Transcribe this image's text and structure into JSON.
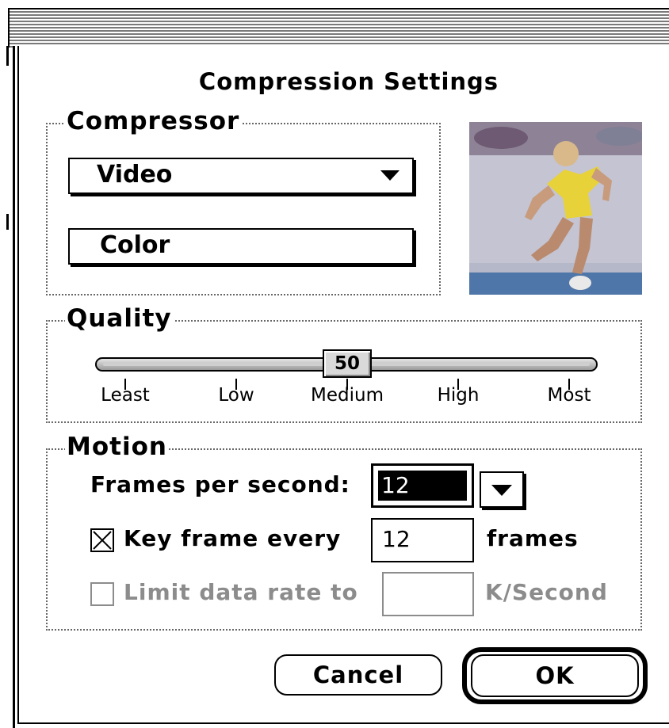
{
  "dialog": {
    "title": "Compression Settings"
  },
  "compressor": {
    "label": "Compressor",
    "type_value": "Video",
    "depth_value": "Color",
    "preview_icon": "preview-image"
  },
  "quality": {
    "label": "Quality",
    "value": 50,
    "slider_fraction": 0.5,
    "ticks": [
      "Least",
      "Low",
      "Medium",
      "High",
      "Most"
    ]
  },
  "motion": {
    "label": "Motion",
    "fps_label": "Frames per second:",
    "fps_value": "12",
    "keyframe_checked": true,
    "keyframe_label": "Key frame every",
    "keyframe_value": "12",
    "keyframe_unit": "frames",
    "limit_checked": false,
    "limit_label": "Limit data rate to",
    "limit_value": "",
    "limit_unit": "K/Second"
  },
  "buttons": {
    "cancel": "Cancel",
    "ok": "OK"
  },
  "colors": {
    "disabled_text": "#8c8c8c",
    "selection_bg": "#000000"
  }
}
